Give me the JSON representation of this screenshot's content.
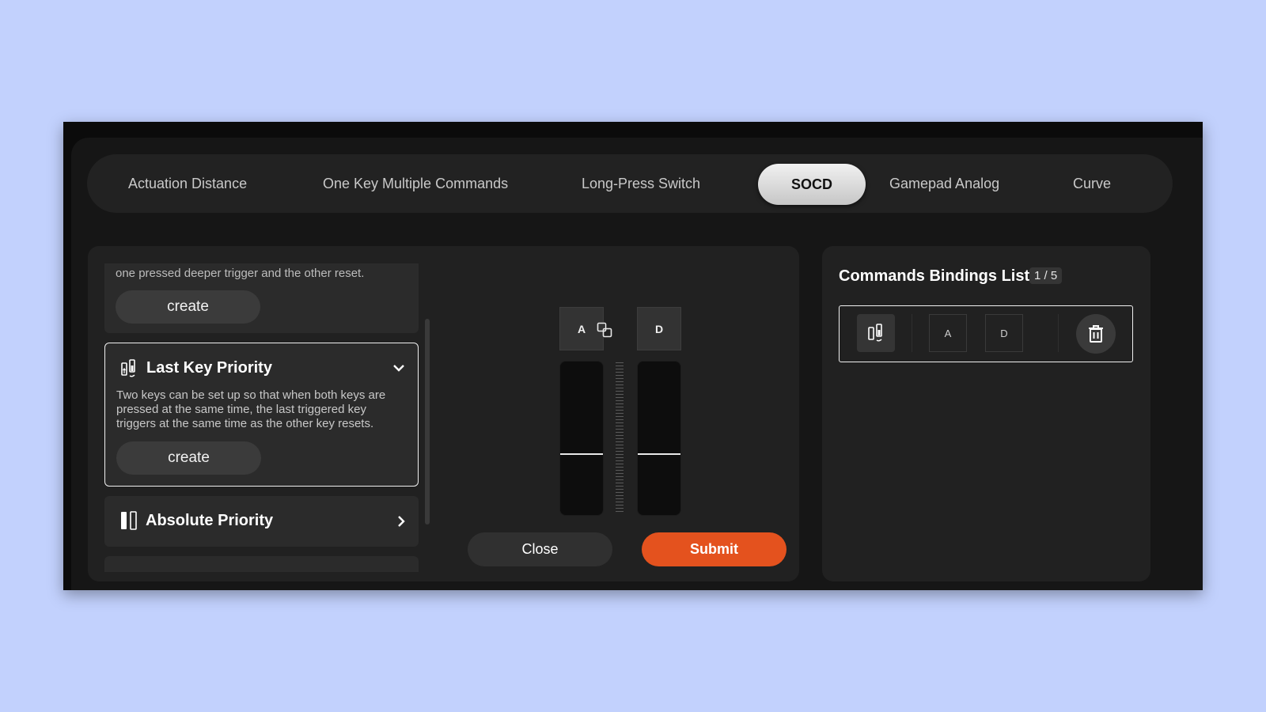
{
  "tabs": [
    {
      "label": "Actuation Distance"
    },
    {
      "label": "One Key Multiple Commands"
    },
    {
      "label": "Long-Press Switch"
    },
    {
      "label": "SOCD"
    },
    {
      "label": "Gamepad Analog"
    },
    {
      "label": "Curve"
    }
  ],
  "active_tab": "SOCD",
  "modes": {
    "top_card": {
      "desc": "one pressed deeper trigger and the other reset.",
      "create_label": "create"
    },
    "last_key_priority": {
      "title": "Last Key Priority",
      "desc": "Two keys can be set up so that when both keys are pressed at the same time, the last triggered key triggers at the same time as the other key resets.",
      "create_label": "create",
      "icon": "last-key-priority-icon"
    },
    "absolute_priority": {
      "title": "Absolute Priority",
      "icon": "absolute-priority-icon"
    }
  },
  "editor": {
    "key_a": "A",
    "key_d": "D",
    "close_label": "Close",
    "submit_label": "Submit",
    "accent": "#e4521e"
  },
  "bindings": {
    "title": "Commands Bindings List",
    "count": "1 / 5",
    "items": [
      {
        "key1": "A",
        "key2": "D",
        "type_icon": "last-key-priority-icon"
      }
    ]
  }
}
